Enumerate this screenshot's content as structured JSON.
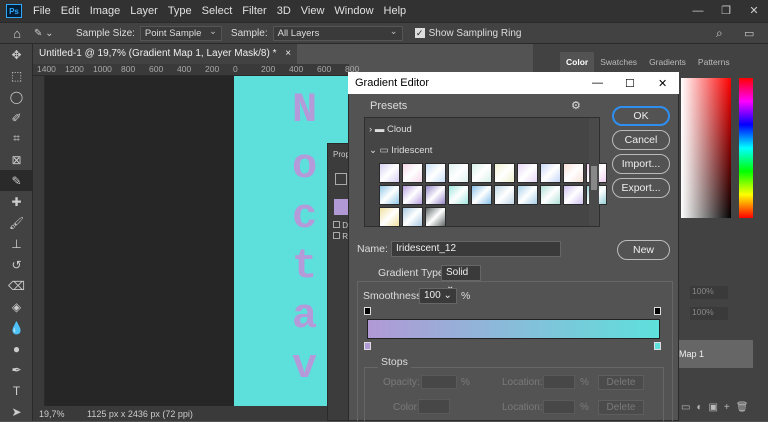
{
  "app": {
    "logo": "Ps"
  },
  "menu": [
    "File",
    "Edit",
    "Image",
    "Layer",
    "Type",
    "Select",
    "Filter",
    "3D",
    "View",
    "Window",
    "Help"
  ],
  "window_controls": [
    "—",
    "❐",
    "✕"
  ],
  "options": {
    "sample_size_label": "Sample Size:",
    "sample_size_value": "Point Sample",
    "sample_label": "Sample:",
    "sample_value": "All Layers",
    "ring_label": "Show Sampling Ring"
  },
  "document": {
    "tab_title": "Untitled-1 @ 19,7% (Gradient Map 1, Layer Mask/8) *",
    "close": "×",
    "ruler_ticks": [
      "1400",
      "1200",
      "1000",
      "800",
      "600",
      "400",
      "200",
      "0",
      "200",
      "400",
      "600",
      "800"
    ],
    "canvas_text": [
      "N",
      "o",
      "c",
      "t",
      "a",
      "v"
    ],
    "zoom": "19,7%",
    "dimensions": "1125 px x 2436 px (72 ppi)"
  },
  "properties": {
    "tab": "Prop",
    "check1": "D",
    "check2": "R"
  },
  "right_panel": {
    "tabs": [
      "Color",
      "Swatches",
      "Gradients",
      "Patterns"
    ],
    "active_tab": "Color",
    "opacity1": "100%",
    "opacity2": "100%",
    "layer_name": "Map 1"
  },
  "dialog": {
    "title": "Gradient Editor",
    "presets_label": "Presets",
    "folders": [
      {
        "name": "Cloud",
        "open": false
      },
      {
        "name": "Iridescent",
        "open": true
      }
    ],
    "swatch_rows": [
      [
        "#d8d0f2",
        "#f4d8e8",
        "#c8e0f8",
        "#e0f0f0",
        "#d8f0e8",
        "#f0f0d0",
        "#e8d8f8",
        "#c8d8f8",
        "#f8e0d8",
        "#f0d0f0"
      ],
      [
        "#90c8e8",
        "#b8a0e0",
        "#9888c8",
        "#a0e8e0",
        "#88c0e8",
        "#c0d8e8",
        "#a8d0e8",
        "#b0e0d8",
        "#d0c0f0",
        "#98d0d8"
      ],
      [
        "#f0e0a0",
        "#a8c8e0",
        "#606868"
      ]
    ],
    "buttons": {
      "ok": "OK",
      "cancel": "Cancel",
      "import": "Import...",
      "export": "Export...",
      "new": "New",
      "delete1": "Delete",
      "delete2": "Delete"
    },
    "name_label": "Name:",
    "name_value": "Iridescent_12",
    "type_label": "Gradient Type:",
    "type_value": "Solid",
    "smooth_label": "Smoothness:",
    "smooth_value": "100",
    "smooth_unit": "%",
    "gradient_colors": {
      "start": "#b199d6",
      "end": "#5ee0dc"
    },
    "stops_label": "Stops",
    "opacity_label": "Opacity:",
    "opacity_unit": "%",
    "location_label": "Location:",
    "location_unit": "%",
    "color_label": "Color:"
  }
}
